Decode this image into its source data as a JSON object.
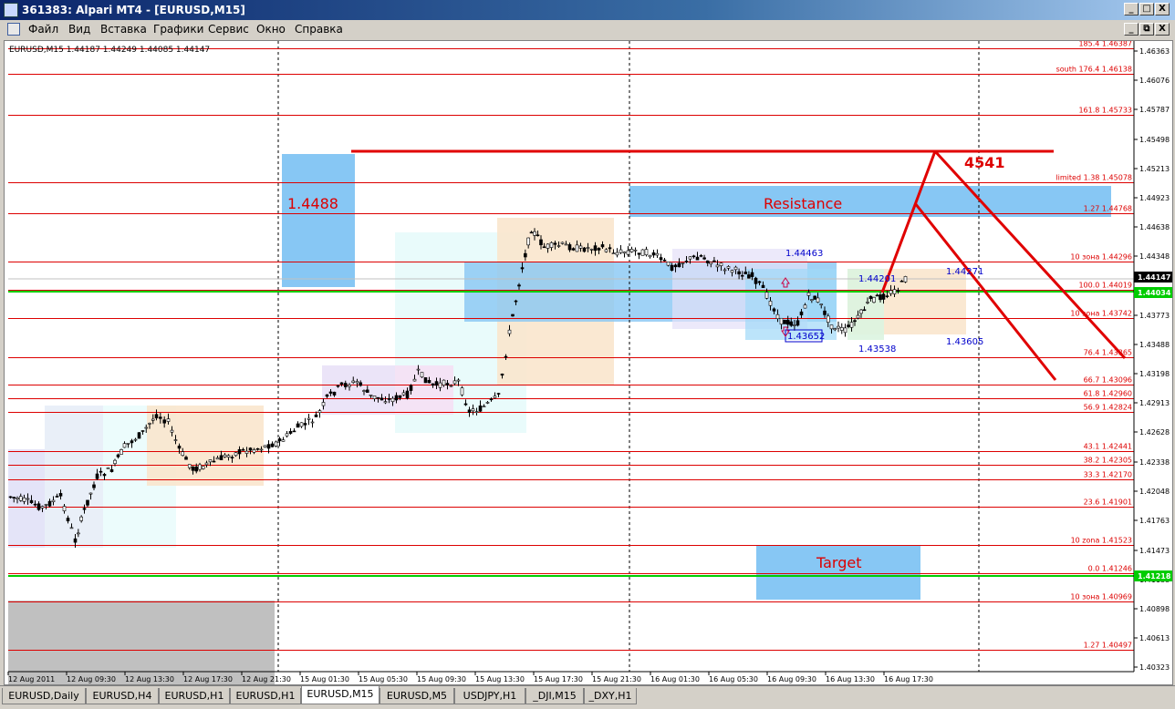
{
  "window": {
    "title": "361383: Alpari MT4 - [EURUSD,M15]",
    "controls": [
      "_",
      "□",
      "X"
    ],
    "doc_controls": [
      "_",
      "⧉",
      "X"
    ]
  },
  "menu": [
    "Файл",
    "Вид",
    "Вставка",
    "Графики",
    "Сервис",
    "Окно",
    "Справка"
  ],
  "chart": {
    "info": "EURUSD,M15  1.44187 1.44249 1.44085 1.44147",
    "symbol": "EURUSD",
    "timeframe": "M15",
    "last_price": 1.44147,
    "price_scale": {
      "ticks": [
        "1.46363",
        "1.46076",
        "1.45787",
        "1.45498",
        "1.45213",
        "1.44923",
        "1.44638",
        "1.44348",
        "1.43773",
        "1.43488",
        "1.43198",
        "1.42913",
        "1.42628",
        "1.42338",
        "1.42048",
        "1.41763",
        "1.41473",
        "1.41188",
        "1.40898",
        "1.40613",
        "1.40323"
      ],
      "current_label": "1.44147",
      "green_label_upper": "1.44034",
      "green_label_lower": "1.41218"
    },
    "time_axis": [
      "12 Aug 2011",
      "12 Aug 09:30",
      "12 Aug 13:30",
      "12 Aug 17:30",
      "12 Aug 21:30",
      "15 Aug 01:30",
      "15 Aug 05:30",
      "15 Aug 09:30",
      "15 Aug 13:30",
      "15 Aug 17:30",
      "15 Aug 21:30",
      "16 Aug 01:30",
      "16 Aug 05:30",
      "16 Aug 09:30",
      "16 Aug 13:30",
      "16 Aug 17:30"
    ],
    "levels": [
      {
        "label": "185.4 1.46387",
        "price": 1.46387
      },
      {
        "label": "south 176.4 1.46138",
        "price": 1.46138
      },
      {
        "label": "161.8 1.45733",
        "price": 1.45733
      },
      {
        "label": "limited 1.38 1.45078",
        "price": 1.45078
      },
      {
        "label": "1.27 1.44768",
        "price": 1.44768
      },
      {
        "label": "10 зона 1.44296",
        "price": 1.44296
      },
      {
        "label": "100.0 1.44019",
        "price": 1.44019
      },
      {
        "label": "10 зона 1.43742",
        "price": 1.43742
      },
      {
        "label": "76.4 1.43365",
        "price": 1.43365
      },
      {
        "label": "66.7 1.43096",
        "price": 1.43096
      },
      {
        "label": "61.8 1.42960",
        "price": 1.4296
      },
      {
        "label": "56.9 1.42824",
        "price": 1.42824
      },
      {
        "label": "43.1 1.42441",
        "price": 1.42441
      },
      {
        "label": "38.2 1.42305",
        "price": 1.42305
      },
      {
        "label": "33.3 1.42170",
        "price": 1.4217
      },
      {
        "label": "23.6 1.41901",
        "price": 1.41901
      },
      {
        "label": "10 zona 1.41523",
        "price": 1.41523
      },
      {
        "label": "0.0 1.41246",
        "price": 1.41246
      },
      {
        "label": "10 зона 1.40969",
        "price": 1.40969
      },
      {
        "label": "1.27 1.40497",
        "price": 1.40497
      }
    ],
    "annotations": {
      "box_left_label": "1.4488",
      "resistance_label": "Resistance",
      "target_label": "Target",
      "red_top_label": "4541",
      "price_labels": [
        "1.44463",
        "1.44201",
        "1.44271",
        "1.43652",
        "1.43538",
        "1.43605"
      ]
    },
    "colors": {
      "level_red": "#dd0000",
      "green_line": "#00cc00",
      "box_blue": "#7fbff0",
      "candle": "#000000",
      "current_price_bg": "#000000",
      "green_label_bg": "#00cc00"
    }
  },
  "tabs": [
    {
      "label": "EURUSD,Daily",
      "active": false
    },
    {
      "label": "EURUSD,H4",
      "active": false
    },
    {
      "label": "EURUSD,H1",
      "active": false
    },
    {
      "label": "EURUSD,H1",
      "active": false
    },
    {
      "label": "EURUSD,M15",
      "active": true
    },
    {
      "label": "EURUSD,M5",
      "active": false
    },
    {
      "label": "USDJPY,H1",
      "active": false
    },
    {
      "label": "_DJI,M15",
      "active": false
    },
    {
      "label": "_DXY,H1",
      "active": false
    }
  ]
}
